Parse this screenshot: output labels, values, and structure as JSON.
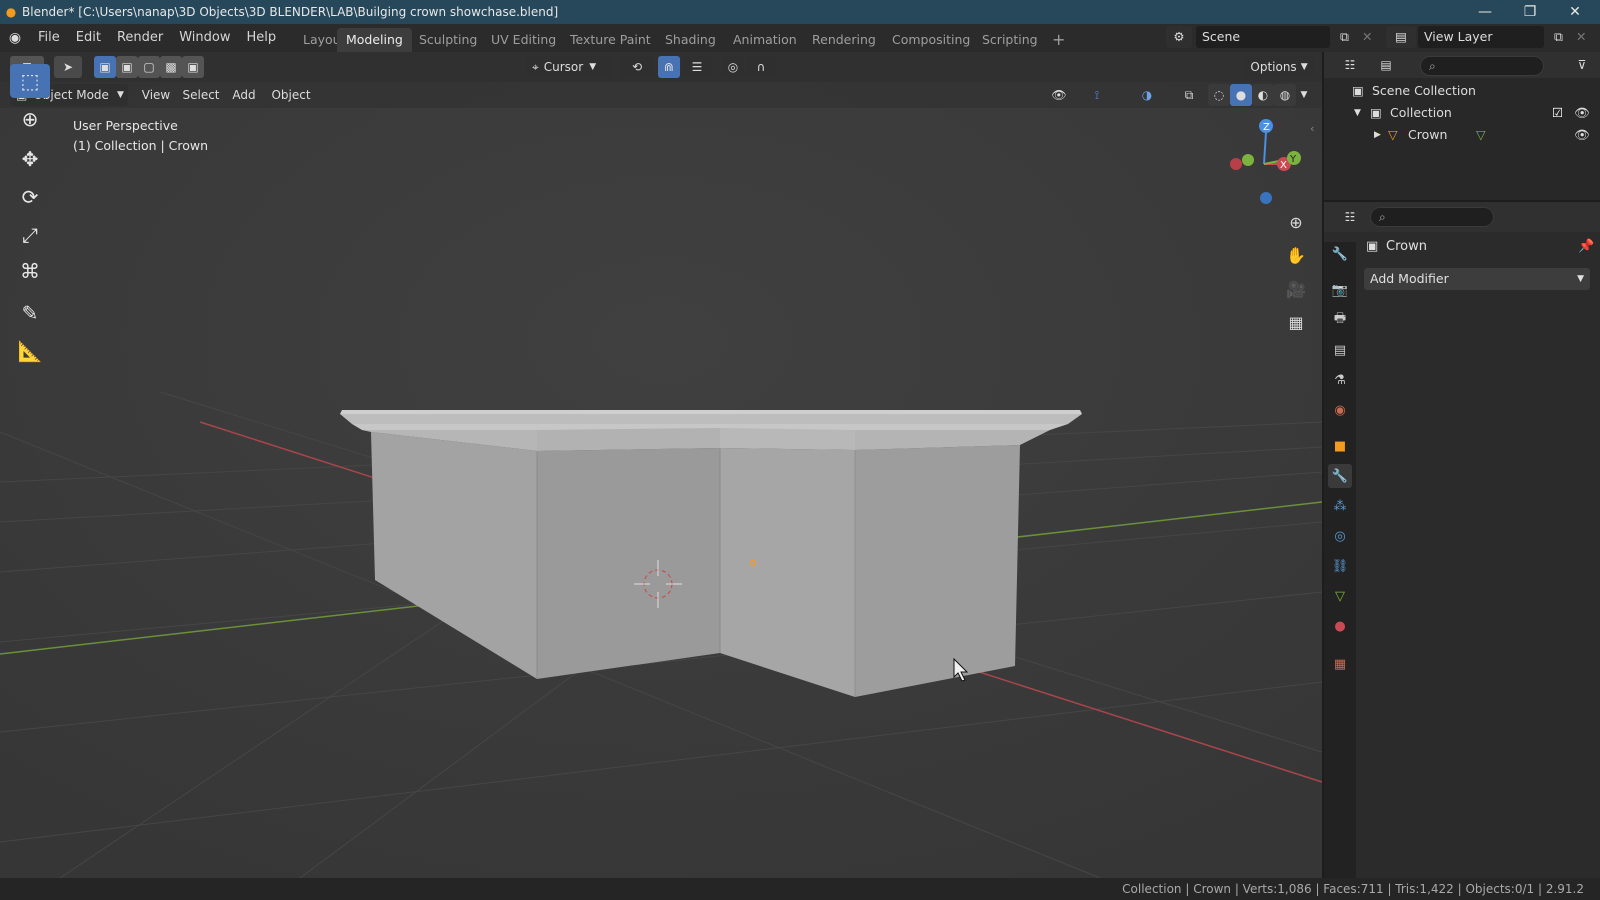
{
  "window": {
    "title": "Blender* [C:\\Users\\nanap\\3D Objects\\3D BLENDER\\LAB\\Builging crown showchase.blend]"
  },
  "menu": [
    "File",
    "Edit",
    "Render",
    "Window",
    "Help"
  ],
  "workspaces": [
    "Layout",
    "Modeling",
    "Sculpting",
    "UV Editing",
    "Texture Paint",
    "Shading",
    "Animation",
    "Rendering",
    "Compositing",
    "Scripting"
  ],
  "active_workspace": "Modeling",
  "scene": {
    "label": "Scene",
    "view_layer": "View Layer"
  },
  "header": {
    "pivot": "Cursor",
    "options": "Options"
  },
  "viewport_menu": {
    "mode": "Object Mode",
    "items": [
      "View",
      "Select",
      "Add",
      "Object"
    ]
  },
  "viewport": {
    "perspective": "User Perspective",
    "context": "(1) Collection | Crown"
  },
  "gizmo": {
    "x": "X",
    "y": "Y",
    "z": "Z"
  },
  "outliner": {
    "scene_collection": "Scene Collection",
    "collection": "Collection",
    "object": "Crown"
  },
  "properties": {
    "object_name": "Crown",
    "add_modifier": "Add Modifier"
  },
  "status": {
    "text": "Collection | Crown  | Verts:1,086 | Faces:711 | Tris:1,422 | Objects:0/1 | 2.91.2"
  },
  "colors": {
    "titlebar": "#26485a",
    "accent": "#4772b3",
    "x_axis": "#c94a52",
    "y_axis": "#7bb33e",
    "z_axis": "#4a8fe0",
    "mesh": "#a9a9a9"
  }
}
